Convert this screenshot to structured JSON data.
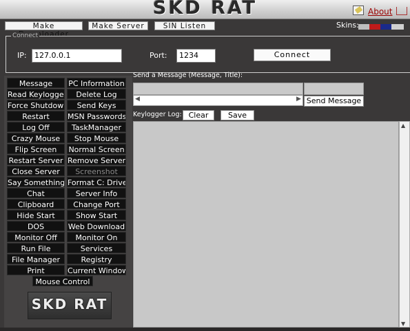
{
  "window": {
    "title": "SKD RAT",
    "about_label": "About"
  },
  "menu": {
    "items": [
      "Make Downloader",
      "Make Server",
      "SIN Listen"
    ],
    "skins_label": "Skins:"
  },
  "connect": {
    "group_label": "Connect",
    "ip_label": "IP:",
    "ip_value": "127.0.0.1",
    "port_label": "Port:",
    "port_value": "1234",
    "button_label": "Connect"
  },
  "commands": [
    {
      "label": "Message",
      "enabled": true
    },
    {
      "label": "PC Information",
      "enabled": true
    },
    {
      "label": "Read Keylogger",
      "enabled": true
    },
    {
      "label": "Delete Log",
      "enabled": true
    },
    {
      "label": "Force Shutdown",
      "enabled": true
    },
    {
      "label": "Send Keys",
      "enabled": true
    },
    {
      "label": "Restart",
      "enabled": true
    },
    {
      "label": "MSN Passwords",
      "enabled": true
    },
    {
      "label": "Log Off",
      "enabled": true
    },
    {
      "label": "TaskManager",
      "enabled": true
    },
    {
      "label": "Crazy Mouse",
      "enabled": true
    },
    {
      "label": "Stop Mouse",
      "enabled": true
    },
    {
      "label": "Flip Screen",
      "enabled": true
    },
    {
      "label": "Normal Screen",
      "enabled": true
    },
    {
      "label": "Restart Server",
      "enabled": true
    },
    {
      "label": "Remove Server",
      "enabled": true
    },
    {
      "label": "Close Server",
      "enabled": true
    },
    {
      "label": "Screenshot",
      "enabled": false
    },
    {
      "label": "Say Something",
      "enabled": true
    },
    {
      "label": "Format C: Drive",
      "enabled": true
    },
    {
      "label": "Chat",
      "enabled": true
    },
    {
      "label": "Server Info",
      "enabled": true
    },
    {
      "label": "Clipboard",
      "enabled": true
    },
    {
      "label": "Change Port",
      "enabled": true
    },
    {
      "label": "Hide Start",
      "enabled": true
    },
    {
      "label": "Show Start",
      "enabled": true
    },
    {
      "label": "DOS",
      "enabled": true
    },
    {
      "label": "Web Download",
      "enabled": true
    },
    {
      "label": "Monitor Off",
      "enabled": true
    },
    {
      "label": "Monitor On",
      "enabled": true
    },
    {
      "label": "Run File",
      "enabled": true
    },
    {
      "label": "Services",
      "enabled": true
    },
    {
      "label": "File Manager",
      "enabled": true
    },
    {
      "label": "Registry",
      "enabled": true
    },
    {
      "label": "Print",
      "enabled": true
    },
    {
      "label": "Current Window",
      "enabled": true
    }
  ],
  "mouse_control_label": "Mouse Control",
  "logo_text": "SKD RAT",
  "message": {
    "label": "Send a Message (Message, Title):",
    "send_label": "Send Message"
  },
  "keylogger": {
    "label": "Keylogger Log:",
    "clear_label": "Clear",
    "save_label": "Save"
  },
  "colors": {
    "background": "#3a3838",
    "button_bg": "#111111",
    "accent_red": "#9a0000",
    "panel_gray": "#c8c8c8"
  }
}
